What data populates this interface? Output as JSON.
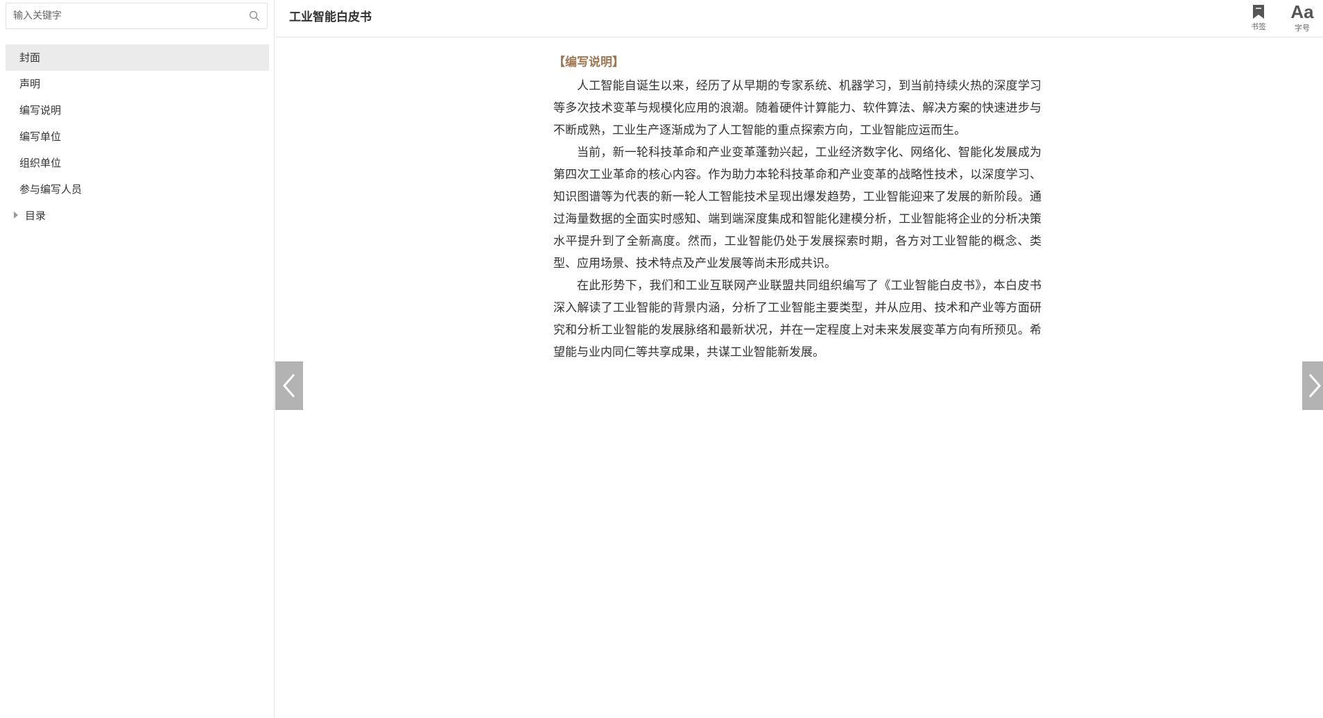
{
  "search": {
    "placeholder": "输入关键字",
    "value": ""
  },
  "sidebar": {
    "items": [
      {
        "label": "封面",
        "active": true
      },
      {
        "label": "声明"
      },
      {
        "label": "编写说明"
      },
      {
        "label": "编写单位"
      },
      {
        "label": "组织单位"
      },
      {
        "label": "参与编写人员"
      },
      {
        "label": "目录",
        "collapsed": true
      }
    ]
  },
  "header": {
    "title": "工业智能白皮书",
    "bookmark_label": "书签",
    "fontsize_label": "字号",
    "fontsize_icon_text": "Aa"
  },
  "content": {
    "heading": "【编写说明】",
    "paragraphs": [
      "人工智能自诞生以来，经历了从早期的专家系统、机器学习，到当前持续火热的深度学习等多次技术变革与规模化应用的浪潮。随着硬件计算能力、软件算法、解决方案的快速进步与不断成熟，工业生产逐渐成为了人工智能的重点探索方向，工业智能应运而生。",
      "当前，新一轮科技革命和产业变革蓬勃兴起，工业经济数字化、网络化、智能化发展成为第四次工业革命的核心内容。作为助力本轮科技革命和产业变革的战略性技术，以深度学习、知识图谱等为代表的新一轮人工智能技术呈现出爆发趋势，工业智能迎来了发展的新阶段。通过海量数据的全面实时感知、端到端深度集成和智能化建模分析，工业智能将企业的分析决策水平提升到了全新高度。然而，工业智能仍处于发展探索时期，各方对工业智能的概念、类型、应用场景、技术特点及产业发展等尚未形成共识。",
      "在此形势下，我们和工业互联网产业联盟共同组织编写了《工业智能白皮书》，本白皮书深入解读了工业智能的背景内涵，分析了工业智能主要类型，并从应用、技术和产业等方面研究和分析工业智能的发展脉络和最新状况，并在一定程度上对未来发展变革方向有所预见。希望能与业内同仁等共享成果，共谋工业智能新发展。"
    ]
  },
  "colors": {
    "heading": "#a3764e",
    "active_item": "#ebebeb",
    "arrow": "#b3b3b3"
  },
  "icons": {
    "search": "search-icon",
    "bookmark": "bookmark-icon",
    "prev": "chevron-left-icon",
    "next": "chevron-right-icon"
  }
}
